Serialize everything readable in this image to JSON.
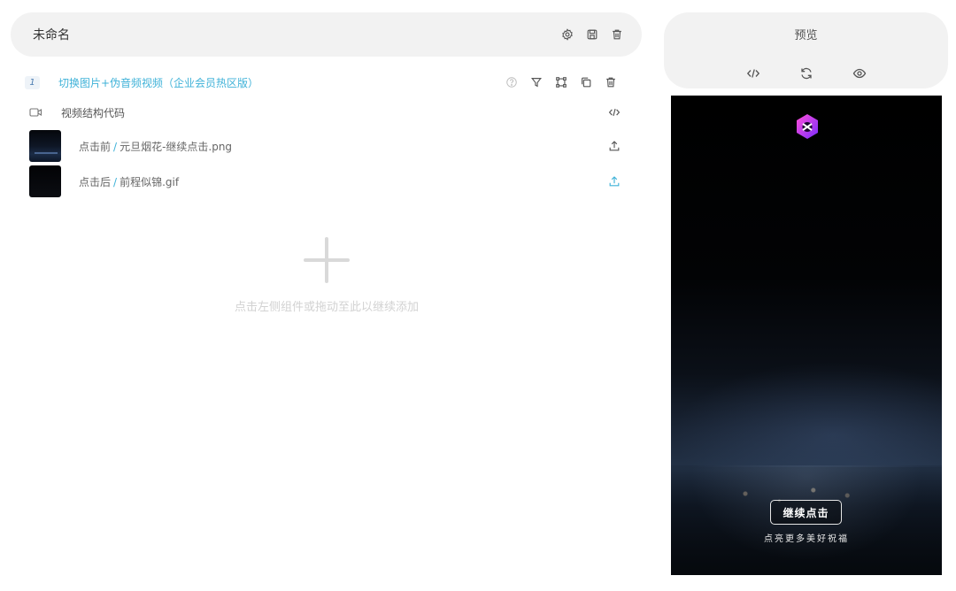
{
  "editor": {
    "doc_title": "未命名",
    "component": {
      "index": "1",
      "title": "切换图片+伪音频视频（企业会员热区版）"
    },
    "section_label": "视频结构代码",
    "files": [
      {
        "label": "点击前",
        "separator": "/",
        "name": "元旦烟花-继续点击.png"
      },
      {
        "label": "点击后",
        "separator": "/",
        "name": "前程似锦.gif"
      }
    ],
    "empty_hint": "点击左侧组件或拖动至此以继续添加"
  },
  "preview": {
    "title": "预览",
    "button_label": "继续点击",
    "subtitle": "点亮更多美好祝福"
  },
  "colors": {
    "accent": "#3fb2d8",
    "panel_bg": "#f2f2f2",
    "hint": "#d2d2d2"
  },
  "icons": [
    "settings-icon",
    "save-icon",
    "trash-icon",
    "help-icon",
    "filter-icon",
    "crop-icon",
    "copy-icon",
    "video-camera-icon",
    "code-icon",
    "upload-icon",
    "plus-icon",
    "refresh-icon",
    "eye-icon"
  ]
}
